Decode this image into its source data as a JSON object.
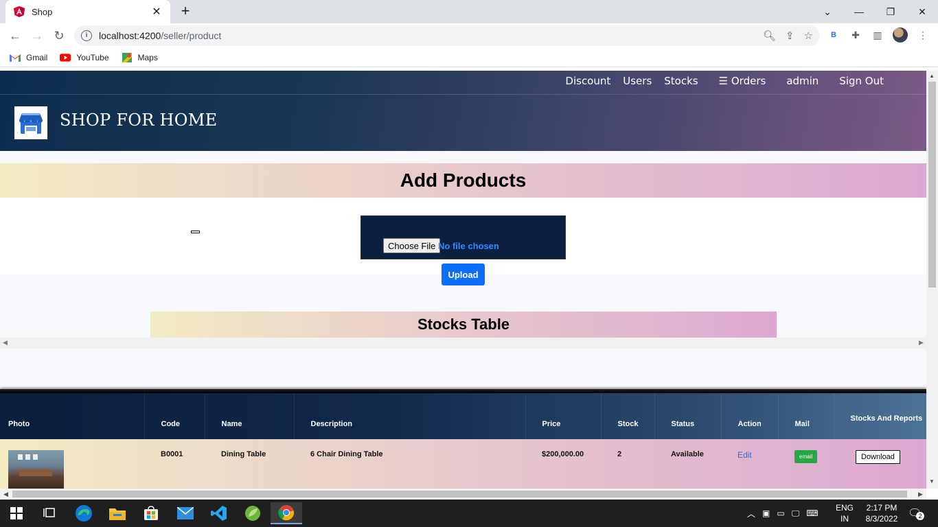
{
  "browser": {
    "tab_title": "Shop",
    "url_host": "localhost:4200",
    "url_path": "/seller/product",
    "bookmarks": [
      {
        "label": "Gmail",
        "icon": "gmail-icon"
      },
      {
        "label": "YouTube",
        "icon": "youtube-icon"
      },
      {
        "label": "Maps",
        "icon": "maps-icon"
      }
    ],
    "extension_letter": "B"
  },
  "nav": {
    "items": [
      "Discount",
      "Users",
      "Stocks"
    ],
    "orders": "Orders",
    "admin": "admin",
    "signout": "Sign Out"
  },
  "header": {
    "brand": "SHOP FOR HOME"
  },
  "upload": {
    "heading": "Add Products",
    "choose_label": "Choose File",
    "no_file_label": "No file chosen",
    "upload_label": "Upload"
  },
  "stocks": {
    "heading": "Stocks Table",
    "columns": [
      "Photo",
      "Code",
      "Name",
      "Description",
      "Price",
      "Stock",
      "Status",
      "Action",
      "Mail",
      "Stocks And Reports"
    ],
    "rows": [
      {
        "code": "B0001",
        "name": "Dining Table",
        "description": "6 Chair Dining Table",
        "price": "$200,000.00",
        "stock": "2",
        "status": "Available",
        "action": "Edit",
        "mail": "email",
        "report": "Download"
      }
    ]
  },
  "taskbar": {
    "lang_top": "ENG",
    "lang_bottom": "IN",
    "time": "2:17 PM",
    "date": "8/3/2022",
    "notifications": "2"
  },
  "colors": {
    "header_start": "#0c2e4e",
    "header_end": "#7c5a86",
    "band_start": "#f3ecc3",
    "band_end": "#dca8d0",
    "upload_button": "#0d6efd",
    "email_button": "#28a745",
    "table_head": "#0a1e3d"
  }
}
